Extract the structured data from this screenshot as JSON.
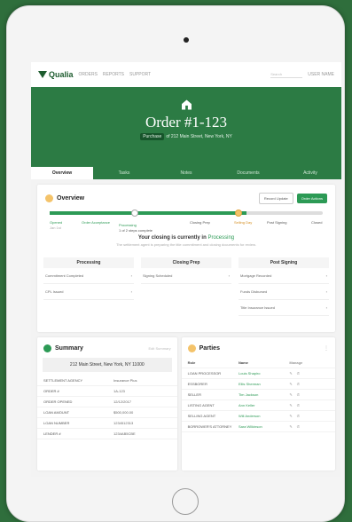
{
  "app": {
    "name": "Qualia",
    "nav_links": [
      "ORDERS",
      "REPORTS",
      "SUPPORT"
    ],
    "search_placeholder": "Search",
    "user": "USER NAME"
  },
  "order": {
    "title": "Order #1-123",
    "badge": "Purchase",
    "address_line": "of 212 Main Street, New York, NY"
  },
  "tabs": [
    "Overview",
    "Tasks",
    "Notes",
    "Documents",
    "Activity"
  ],
  "overview": {
    "title": "Overview",
    "buttons": {
      "secondary": "Record Update",
      "primary": "Order Actions"
    },
    "progress_fraction": 0.72,
    "stages": [
      "Opened",
      "Order Acceptance",
      "Processing",
      "Closing Prep",
      "Selling Day",
      "Post Signing",
      "Closed"
    ],
    "processing_note": "1 of 2 steps complete",
    "opened_date": "Jan 1st",
    "status_text": "Your closing is currently in",
    "status_value": "Processing",
    "status_sub": "The settlement agent is preparing the title commitment and closing documents for review.",
    "columns": [
      {
        "title": "Processing",
        "items": [
          "Commitment Completed",
          "CPL Issued"
        ]
      },
      {
        "title": "Closing Prep",
        "items": [
          "Signing Scheduled"
        ]
      },
      {
        "title": "Post Signing",
        "items": [
          "Mortgage Recorded",
          "Funds Disbursed",
          "Title Insurance Issued"
        ]
      }
    ]
  },
  "summary": {
    "title": "Summary",
    "action": "Edit Summary",
    "address": "212 Main Street, New York, NY 11000",
    "rows": [
      {
        "label": "SETTLEMENT AGENCY",
        "value": "Insurance Plus"
      },
      {
        "label": "ORDER #",
        "value": "1A-123"
      },
      {
        "label": "ORDER OPENED",
        "value": "12/12/2017"
      },
      {
        "label": "LOAN AMOUNT",
        "value": "$500,000.00"
      },
      {
        "label": "LOAN NUMBER",
        "value": "1234512313"
      },
      {
        "label": "LENDER #",
        "value": "1234AB5CBE"
      }
    ]
  },
  "parties": {
    "title": "Parties",
    "headers": [
      "Role",
      "Name",
      "Manage"
    ],
    "rows": [
      {
        "role": "LOAN PROCESSOR",
        "name": "Louis Shapiro"
      },
      {
        "role": "ESSBORER",
        "name": "Ellis Sherman"
      },
      {
        "role": "SELLER",
        "name": "Tim Jackson"
      },
      {
        "role": "LISTING AGENT",
        "name": "Ann Keller"
      },
      {
        "role": "SELLING AGENT",
        "name": "Will Anderson"
      },
      {
        "role": "BORROWER'S ATTORNEY",
        "name": "Sara Wilkinson"
      }
    ]
  },
  "colors": {
    "brand": "#2c7b44",
    "accent": "#2c9a55",
    "current_stage": "#f4c36a",
    "background": "#2f6e3c"
  }
}
